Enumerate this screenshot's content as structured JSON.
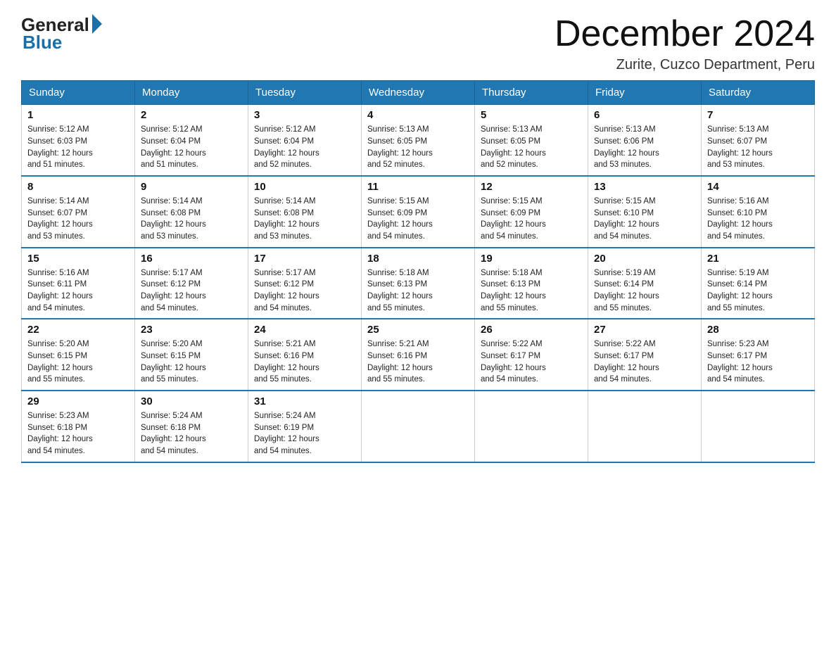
{
  "logo": {
    "general": "General",
    "blue": "Blue"
  },
  "title": {
    "month": "December 2024",
    "location": "Zurite, Cuzco Department, Peru"
  },
  "header_days": [
    "Sunday",
    "Monday",
    "Tuesday",
    "Wednesday",
    "Thursday",
    "Friday",
    "Saturday"
  ],
  "weeks": [
    [
      {
        "day": "1",
        "sunrise": "5:12 AM",
        "sunset": "6:03 PM",
        "daylight": "12 hours and 51 minutes."
      },
      {
        "day": "2",
        "sunrise": "5:12 AM",
        "sunset": "6:04 PM",
        "daylight": "12 hours and 51 minutes."
      },
      {
        "day": "3",
        "sunrise": "5:12 AM",
        "sunset": "6:04 PM",
        "daylight": "12 hours and 52 minutes."
      },
      {
        "day": "4",
        "sunrise": "5:13 AM",
        "sunset": "6:05 PM",
        "daylight": "12 hours and 52 minutes."
      },
      {
        "day": "5",
        "sunrise": "5:13 AM",
        "sunset": "6:05 PM",
        "daylight": "12 hours and 52 minutes."
      },
      {
        "day": "6",
        "sunrise": "5:13 AM",
        "sunset": "6:06 PM",
        "daylight": "12 hours and 53 minutes."
      },
      {
        "day": "7",
        "sunrise": "5:13 AM",
        "sunset": "6:07 PM",
        "daylight": "12 hours and 53 minutes."
      }
    ],
    [
      {
        "day": "8",
        "sunrise": "5:14 AM",
        "sunset": "6:07 PM",
        "daylight": "12 hours and 53 minutes."
      },
      {
        "day": "9",
        "sunrise": "5:14 AM",
        "sunset": "6:08 PM",
        "daylight": "12 hours and 53 minutes."
      },
      {
        "day": "10",
        "sunrise": "5:14 AM",
        "sunset": "6:08 PM",
        "daylight": "12 hours and 53 minutes."
      },
      {
        "day": "11",
        "sunrise": "5:15 AM",
        "sunset": "6:09 PM",
        "daylight": "12 hours and 54 minutes."
      },
      {
        "day": "12",
        "sunrise": "5:15 AM",
        "sunset": "6:09 PM",
        "daylight": "12 hours and 54 minutes."
      },
      {
        "day": "13",
        "sunrise": "5:15 AM",
        "sunset": "6:10 PM",
        "daylight": "12 hours and 54 minutes."
      },
      {
        "day": "14",
        "sunrise": "5:16 AM",
        "sunset": "6:10 PM",
        "daylight": "12 hours and 54 minutes."
      }
    ],
    [
      {
        "day": "15",
        "sunrise": "5:16 AM",
        "sunset": "6:11 PM",
        "daylight": "12 hours and 54 minutes."
      },
      {
        "day": "16",
        "sunrise": "5:17 AM",
        "sunset": "6:12 PM",
        "daylight": "12 hours and 54 minutes."
      },
      {
        "day": "17",
        "sunrise": "5:17 AM",
        "sunset": "6:12 PM",
        "daylight": "12 hours and 54 minutes."
      },
      {
        "day": "18",
        "sunrise": "5:18 AM",
        "sunset": "6:13 PM",
        "daylight": "12 hours and 55 minutes."
      },
      {
        "day": "19",
        "sunrise": "5:18 AM",
        "sunset": "6:13 PM",
        "daylight": "12 hours and 55 minutes."
      },
      {
        "day": "20",
        "sunrise": "5:19 AM",
        "sunset": "6:14 PM",
        "daylight": "12 hours and 55 minutes."
      },
      {
        "day": "21",
        "sunrise": "5:19 AM",
        "sunset": "6:14 PM",
        "daylight": "12 hours and 55 minutes."
      }
    ],
    [
      {
        "day": "22",
        "sunrise": "5:20 AM",
        "sunset": "6:15 PM",
        "daylight": "12 hours and 55 minutes."
      },
      {
        "day": "23",
        "sunrise": "5:20 AM",
        "sunset": "6:15 PM",
        "daylight": "12 hours and 55 minutes."
      },
      {
        "day": "24",
        "sunrise": "5:21 AM",
        "sunset": "6:16 PM",
        "daylight": "12 hours and 55 minutes."
      },
      {
        "day": "25",
        "sunrise": "5:21 AM",
        "sunset": "6:16 PM",
        "daylight": "12 hours and 55 minutes."
      },
      {
        "day": "26",
        "sunrise": "5:22 AM",
        "sunset": "6:17 PM",
        "daylight": "12 hours and 54 minutes."
      },
      {
        "day": "27",
        "sunrise": "5:22 AM",
        "sunset": "6:17 PM",
        "daylight": "12 hours and 54 minutes."
      },
      {
        "day": "28",
        "sunrise": "5:23 AM",
        "sunset": "6:17 PM",
        "daylight": "12 hours and 54 minutes."
      }
    ],
    [
      {
        "day": "29",
        "sunrise": "5:23 AM",
        "sunset": "6:18 PM",
        "daylight": "12 hours and 54 minutes."
      },
      {
        "day": "30",
        "sunrise": "5:24 AM",
        "sunset": "6:18 PM",
        "daylight": "12 hours and 54 minutes."
      },
      {
        "day": "31",
        "sunrise": "5:24 AM",
        "sunset": "6:19 PM",
        "daylight": "12 hours and 54 minutes."
      },
      null,
      null,
      null,
      null
    ]
  ],
  "labels": {
    "sunrise": "Sunrise:",
    "sunset": "Sunset:",
    "daylight": "Daylight:"
  }
}
